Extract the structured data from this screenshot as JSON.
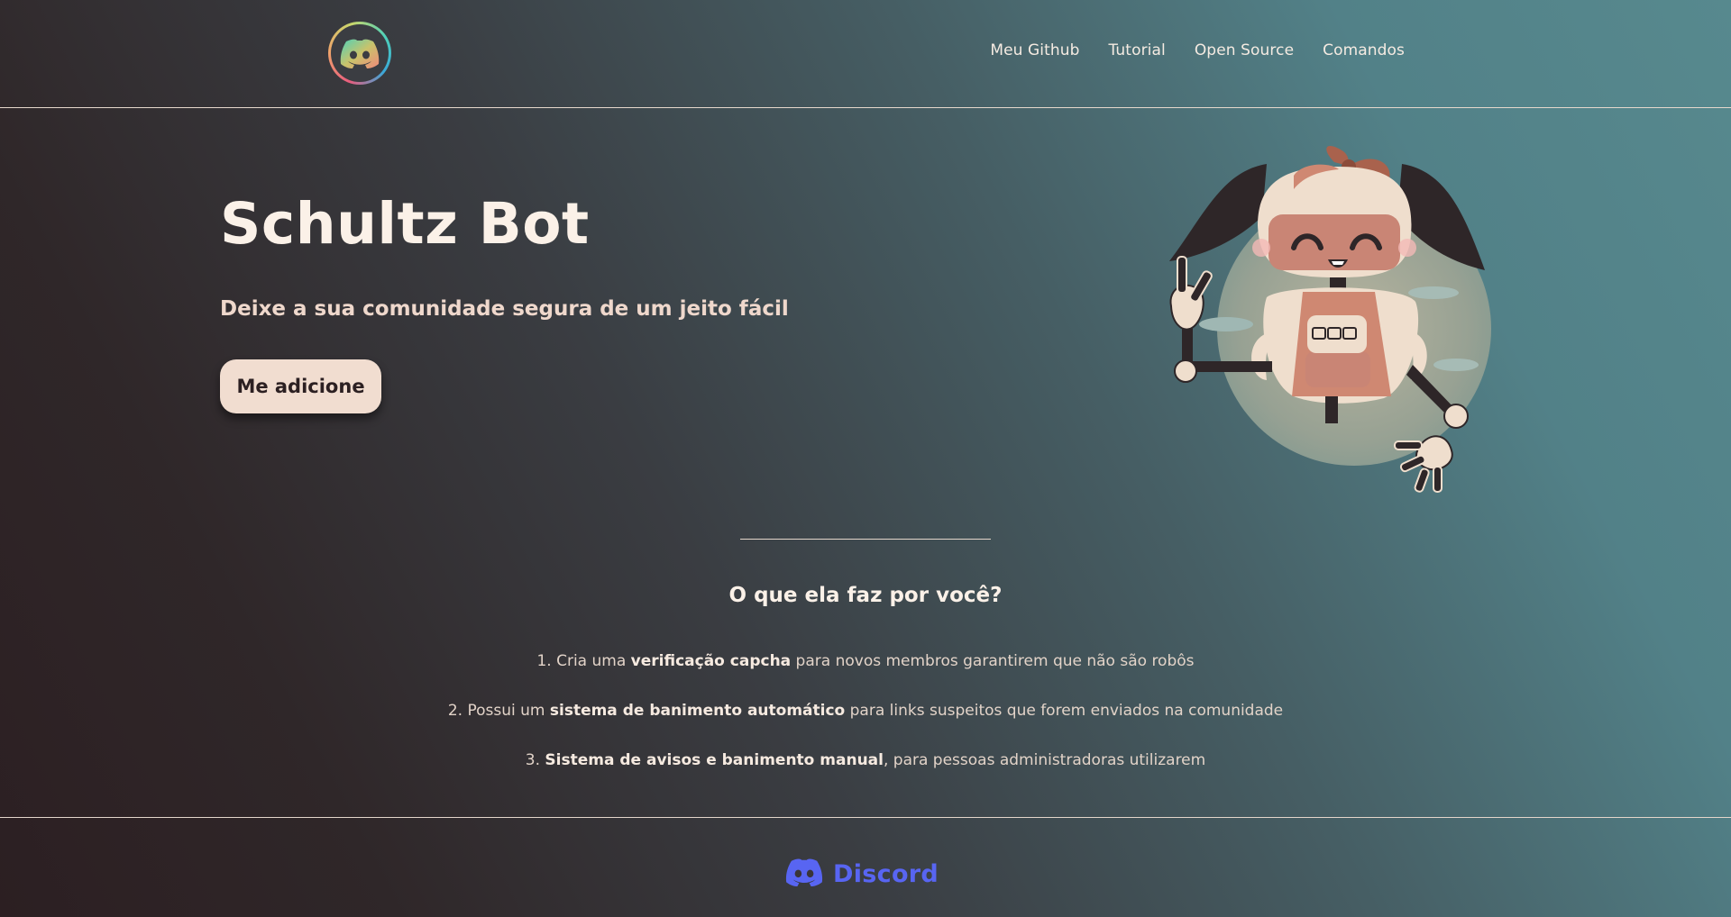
{
  "header": {
    "logo_icon": "discord-logo-icon",
    "nav": [
      {
        "label": "Meu Github"
      },
      {
        "label": "Tutorial"
      },
      {
        "label": "Open Source"
      },
      {
        "label": "Comandos"
      }
    ]
  },
  "hero": {
    "title": "Schultz Bot",
    "subtitle": "Deixe a sua comunidade segura de um jeito fácil",
    "cta_label": "Me adicione",
    "illustration": "robot-girl-illustration"
  },
  "features": {
    "title": "O que ela faz por você?",
    "items": [
      {
        "prefix": "1. Cria uma ",
        "bold": "verificação capcha",
        "suffix": " para novos membros garantirem que não são robôs"
      },
      {
        "prefix": "2. Possui um ",
        "bold": "sistema de banimento automático",
        "suffix": " para links suspeitos que forem enviados na comunidade"
      },
      {
        "prefix": "3. ",
        "bold": "Sistema de avisos e banimento manual",
        "suffix": ", para pessoas administradoras utilizarem"
      }
    ]
  },
  "footer": {
    "brand": "Discord",
    "brand_icon": "discord-icon"
  },
  "colors": {
    "accent": "#f1ddd0",
    "discord": "#5865f2",
    "text": "#fbf1e8"
  }
}
